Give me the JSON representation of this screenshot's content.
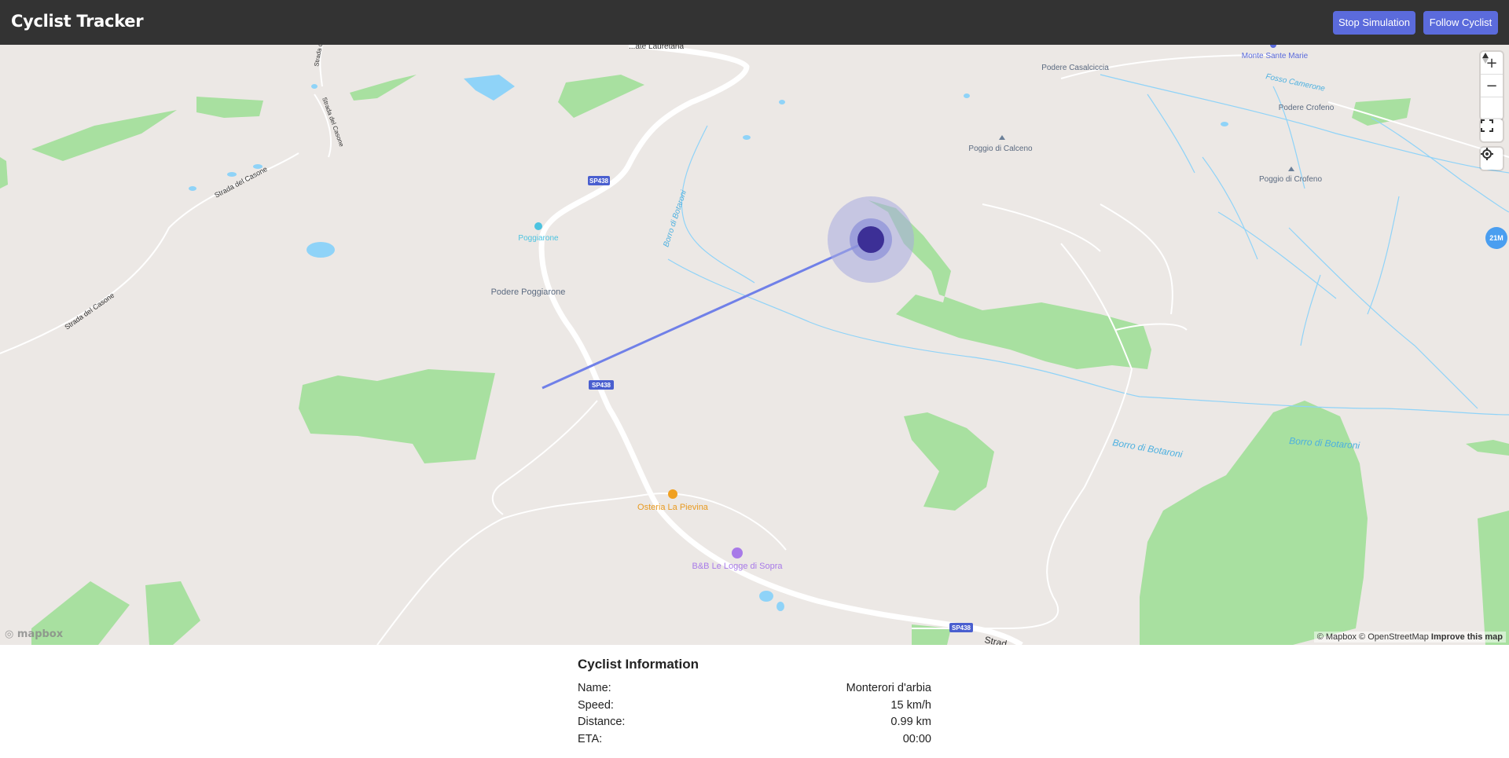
{
  "header": {
    "title": "Cyclist Tracker",
    "stop_label": "Stop Simulation",
    "follow_label": "Follow Cyclist",
    "button_color": "#5b6bdc"
  },
  "map": {
    "place_labels": {
      "lauretana": "...ate Lauretana",
      "podere_casalciccia": "Podere Casalciccia",
      "monte_sante_marie": "Monte Sante Marie",
      "fosso_camerone": "Fosso Camerone",
      "podere_crofeno": "Podere Crofeno",
      "poggio_di_calceno": "Poggio di Calceno",
      "poggio_di_crofeno": "Poggio di Crofeno",
      "poggiarone": "Poggiarone",
      "podere_poggiarone": "Podere Poggiarone",
      "strada_del_casone_1": "Strada del Casone",
      "strada_del_casone_2": "Strada del Casone",
      "strada_del_casone_3": "Strada del Casone",
      "strada_top": "Strada d...",
      "borro_vertical": "Borro di Botaroni",
      "borro_1": "Borro di Botaroni",
      "borro_2": "Borro di Botaroni",
      "osteria": "Osteria La Pievina",
      "bnb": "B&B Le Logge di Sopra",
      "strada_bottom": "Strad...",
      "route_badge": "SP438",
      "marker_badge": "21M"
    },
    "attribution": "© Mapbox © OpenStreetMap",
    "improve_label": "Improve this map",
    "logo_text": "mapbox",
    "controls": {
      "zoom_in": "+",
      "zoom_out": "−"
    },
    "colors": {
      "land": "#ece8e5",
      "park": "#a8e0a0",
      "water": "#8fd3f8",
      "route_line": "#7080e8",
      "cyclist_marker": "#3c2f96",
      "accuracy_halo": "#a8aae0"
    }
  },
  "cyclist_info": {
    "title": "Cyclist Information",
    "rows": [
      {
        "label": "Name:",
        "value": "Monterori d'arbia"
      },
      {
        "label": "Speed:",
        "value": "15 km/h"
      },
      {
        "label": "Distance:",
        "value": "0.99 km"
      },
      {
        "label": "ETA:",
        "value": "00:00"
      }
    ]
  }
}
